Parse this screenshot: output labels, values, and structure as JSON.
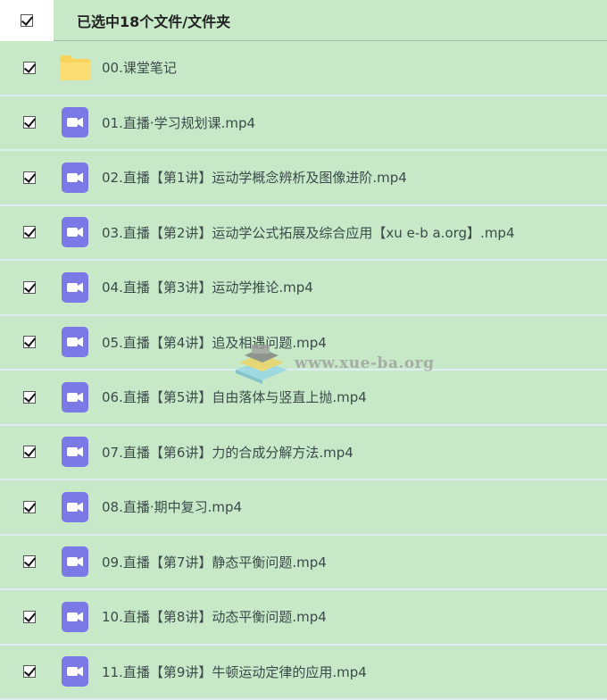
{
  "header": {
    "title": "已选中18个文件/文件夹"
  },
  "files": [
    {
      "name": "00.课堂笔记",
      "type": "folder"
    },
    {
      "name": "01.直播·学习规划课.mp4",
      "type": "video"
    },
    {
      "name": "02.直播【第1讲】运动学概念辨析及图像进阶.mp4",
      "type": "video"
    },
    {
      "name": "03.直播【第2讲】运动学公式拓展及综合应用【xu e-b a.org】.mp4",
      "type": "video"
    },
    {
      "name": "04.直播【第3讲】运动学推论.mp4",
      "type": "video"
    },
    {
      "name": "05.直播【第4讲】追及相遇问题.mp4",
      "type": "video"
    },
    {
      "name": "06.直播【第5讲】自由落体与竖直上抛.mp4",
      "type": "video"
    },
    {
      "name": "07.直播【第6讲】力的合成分解方法.mp4",
      "type": "video"
    },
    {
      "name": "08.直播·期中复习.mp4",
      "type": "video"
    },
    {
      "name": "09.直播【第7讲】静态平衡问题.mp4",
      "type": "video"
    },
    {
      "name": "10.直播【第8讲】动态平衡问题.mp4",
      "type": "video"
    },
    {
      "name": "11.直播【第9讲】牛顿运动定律的应用.mp4",
      "type": "video"
    }
  ],
  "watermark": {
    "text": "www.xue-ba.org"
  },
  "colors": {
    "background": "#c7e9c8",
    "folder": "#f9d45c",
    "video": "#7b79e6"
  },
  "icons": {
    "folder": "folder-icon",
    "video": "video-file-icon",
    "checkbox": "checkbox-checked-icon"
  }
}
